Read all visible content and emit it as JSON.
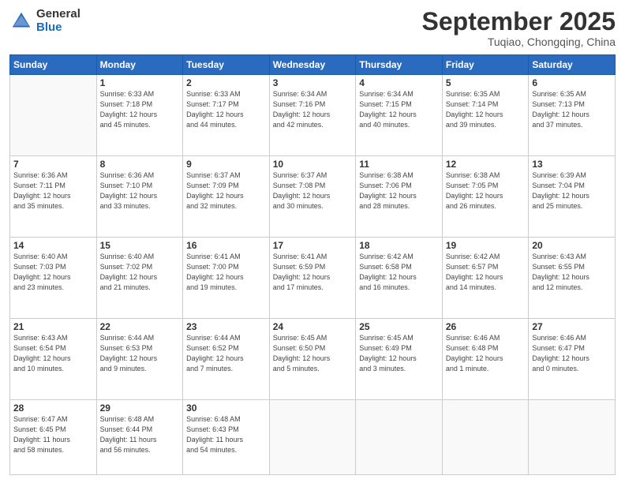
{
  "logo": {
    "general": "General",
    "blue": "Blue"
  },
  "header": {
    "month": "September 2025",
    "location": "Tuqiao, Chongqing, China"
  },
  "weekdays": [
    "Sunday",
    "Monday",
    "Tuesday",
    "Wednesday",
    "Thursday",
    "Friday",
    "Saturday"
  ],
  "weeks": [
    [
      {
        "day": "",
        "info": ""
      },
      {
        "day": "1",
        "info": "Sunrise: 6:33 AM\nSunset: 7:18 PM\nDaylight: 12 hours\nand 45 minutes."
      },
      {
        "day": "2",
        "info": "Sunrise: 6:33 AM\nSunset: 7:17 PM\nDaylight: 12 hours\nand 44 minutes."
      },
      {
        "day": "3",
        "info": "Sunrise: 6:34 AM\nSunset: 7:16 PM\nDaylight: 12 hours\nand 42 minutes."
      },
      {
        "day": "4",
        "info": "Sunrise: 6:34 AM\nSunset: 7:15 PM\nDaylight: 12 hours\nand 40 minutes."
      },
      {
        "day": "5",
        "info": "Sunrise: 6:35 AM\nSunset: 7:14 PM\nDaylight: 12 hours\nand 39 minutes."
      },
      {
        "day": "6",
        "info": "Sunrise: 6:35 AM\nSunset: 7:13 PM\nDaylight: 12 hours\nand 37 minutes."
      }
    ],
    [
      {
        "day": "7",
        "info": "Sunrise: 6:36 AM\nSunset: 7:11 PM\nDaylight: 12 hours\nand 35 minutes."
      },
      {
        "day": "8",
        "info": "Sunrise: 6:36 AM\nSunset: 7:10 PM\nDaylight: 12 hours\nand 33 minutes."
      },
      {
        "day": "9",
        "info": "Sunrise: 6:37 AM\nSunset: 7:09 PM\nDaylight: 12 hours\nand 32 minutes."
      },
      {
        "day": "10",
        "info": "Sunrise: 6:37 AM\nSunset: 7:08 PM\nDaylight: 12 hours\nand 30 minutes."
      },
      {
        "day": "11",
        "info": "Sunrise: 6:38 AM\nSunset: 7:06 PM\nDaylight: 12 hours\nand 28 minutes."
      },
      {
        "day": "12",
        "info": "Sunrise: 6:38 AM\nSunset: 7:05 PM\nDaylight: 12 hours\nand 26 minutes."
      },
      {
        "day": "13",
        "info": "Sunrise: 6:39 AM\nSunset: 7:04 PM\nDaylight: 12 hours\nand 25 minutes."
      }
    ],
    [
      {
        "day": "14",
        "info": "Sunrise: 6:40 AM\nSunset: 7:03 PM\nDaylight: 12 hours\nand 23 minutes."
      },
      {
        "day": "15",
        "info": "Sunrise: 6:40 AM\nSunset: 7:02 PM\nDaylight: 12 hours\nand 21 minutes."
      },
      {
        "day": "16",
        "info": "Sunrise: 6:41 AM\nSunset: 7:00 PM\nDaylight: 12 hours\nand 19 minutes."
      },
      {
        "day": "17",
        "info": "Sunrise: 6:41 AM\nSunset: 6:59 PM\nDaylight: 12 hours\nand 17 minutes."
      },
      {
        "day": "18",
        "info": "Sunrise: 6:42 AM\nSunset: 6:58 PM\nDaylight: 12 hours\nand 16 minutes."
      },
      {
        "day": "19",
        "info": "Sunrise: 6:42 AM\nSunset: 6:57 PM\nDaylight: 12 hours\nand 14 minutes."
      },
      {
        "day": "20",
        "info": "Sunrise: 6:43 AM\nSunset: 6:55 PM\nDaylight: 12 hours\nand 12 minutes."
      }
    ],
    [
      {
        "day": "21",
        "info": "Sunrise: 6:43 AM\nSunset: 6:54 PM\nDaylight: 12 hours\nand 10 minutes."
      },
      {
        "day": "22",
        "info": "Sunrise: 6:44 AM\nSunset: 6:53 PM\nDaylight: 12 hours\nand 9 minutes."
      },
      {
        "day": "23",
        "info": "Sunrise: 6:44 AM\nSunset: 6:52 PM\nDaylight: 12 hours\nand 7 minutes."
      },
      {
        "day": "24",
        "info": "Sunrise: 6:45 AM\nSunset: 6:50 PM\nDaylight: 12 hours\nand 5 minutes."
      },
      {
        "day": "25",
        "info": "Sunrise: 6:45 AM\nSunset: 6:49 PM\nDaylight: 12 hours\nand 3 minutes."
      },
      {
        "day": "26",
        "info": "Sunrise: 6:46 AM\nSunset: 6:48 PM\nDaylight: 12 hours\nand 1 minute."
      },
      {
        "day": "27",
        "info": "Sunrise: 6:46 AM\nSunset: 6:47 PM\nDaylight: 12 hours\nand 0 minutes."
      }
    ],
    [
      {
        "day": "28",
        "info": "Sunrise: 6:47 AM\nSunset: 6:45 PM\nDaylight: 11 hours\nand 58 minutes."
      },
      {
        "day": "29",
        "info": "Sunrise: 6:48 AM\nSunset: 6:44 PM\nDaylight: 11 hours\nand 56 minutes."
      },
      {
        "day": "30",
        "info": "Sunrise: 6:48 AM\nSunset: 6:43 PM\nDaylight: 11 hours\nand 54 minutes."
      },
      {
        "day": "",
        "info": ""
      },
      {
        "day": "",
        "info": ""
      },
      {
        "day": "",
        "info": ""
      },
      {
        "day": "",
        "info": ""
      }
    ]
  ]
}
